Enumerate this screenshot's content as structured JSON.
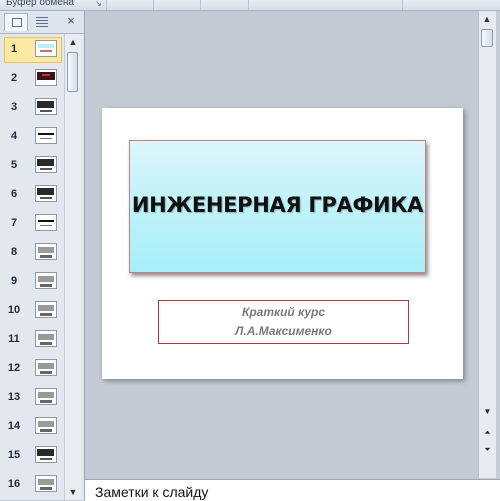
{
  "ribbon": {
    "group_label": "Буфер обмена"
  },
  "panel": {
    "tabs": [
      {
        "name": "slides-tab",
        "icon": "slides-icon"
      },
      {
        "name": "outline-tab",
        "icon": "outline-icon"
      }
    ],
    "close_label": "×",
    "slides": [
      {
        "number": "1",
        "style": "title",
        "selected": true
      },
      {
        "number": "2",
        "style": "red"
      },
      {
        "number": "3",
        "style": "dark"
      },
      {
        "number": "4",
        "style": "line"
      },
      {
        "number": "5",
        "style": "dark"
      },
      {
        "number": "6",
        "style": "dark"
      },
      {
        "number": "7",
        "style": "line"
      },
      {
        "number": "8",
        "style": "grey"
      },
      {
        "number": "9",
        "style": "grey"
      },
      {
        "number": "10",
        "style": "grey"
      },
      {
        "number": "11",
        "style": "grey"
      },
      {
        "number": "12",
        "style": "grey"
      },
      {
        "number": "13",
        "style": "grey"
      },
      {
        "number": "14",
        "style": "grey"
      },
      {
        "number": "15",
        "style": "dark"
      },
      {
        "number": "16",
        "style": "grey"
      }
    ]
  },
  "slide": {
    "title": "ИНЖЕНЕРНАЯ ГРАФИКА",
    "subtitle_line1": "Краткий курс",
    "subtitle_line2": "Л.А.Максименко"
  },
  "notes": {
    "placeholder": "Заметки к слайду"
  }
}
